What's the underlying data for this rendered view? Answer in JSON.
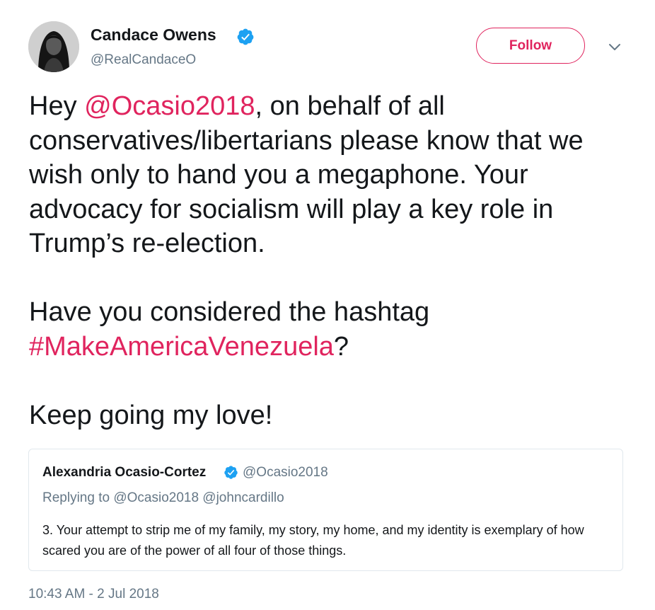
{
  "author": {
    "display_name": "Candace Owens",
    "handle": "@RealCandaceO",
    "verified": true
  },
  "follow_button": {
    "label": "Follow"
  },
  "tweet": {
    "text_parts": [
      {
        "text": "Hey ",
        "type": "text"
      },
      {
        "text": "@Ocasio2018",
        "type": "link"
      },
      {
        "text": ", on behalf of all conservatives/libertarians please know that we wish only to hand you a megaphone. Your advocacy for socialism will play a key role in Trump’s re-election.\n\nHave you considered the hashtag ",
        "type": "text"
      },
      {
        "text": "#MakeAmericaVenezuela",
        "type": "link"
      },
      {
        "text": "?\n\nKeep going my love!",
        "type": "text"
      }
    ],
    "timestamp": "10:43 AM - 2 Jul 2018"
  },
  "quoted_tweet": {
    "display_name": "Alexandria Ocasio-Cortez",
    "handle": "@Ocasio2018",
    "verified": true,
    "replying_to": "Replying to @Ocasio2018 @johncardillo",
    "text": "3. Your attempt to strip me of my family, my story, my home, and my identity is exemplary of how scared you are of the power of all four of those things."
  },
  "colors": {
    "link": "#e0245e",
    "verified": "#1da1f2",
    "secondary_text": "#657786",
    "primary_text": "#14171a"
  },
  "icons": {
    "verified": "verified-badge-icon",
    "more": "chevron-down-icon"
  }
}
